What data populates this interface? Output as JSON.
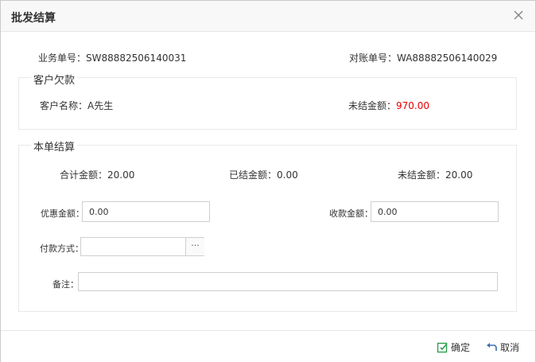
{
  "dialog": {
    "title": "批发结算",
    "close_icon": "close-icon"
  },
  "header": {
    "order_no_label": "业务单号：SW88882506140031",
    "statement_no_label": "对账单号：WA88882506140029"
  },
  "customer_debt": {
    "legend": "客户欠款",
    "customer_name": "客户名称：A先生",
    "unsettled_label": "未结金额：",
    "unsettled_value": "970.00",
    "unsettled_color": "#e60000"
  },
  "settlement": {
    "legend": "本单结算",
    "total": "合计金额：20.00",
    "settled": "已结金额：0.00",
    "unsettled": "未结金额：20.00",
    "discount_label": "优惠金额：",
    "discount_value": "0.00",
    "received_label": "收款金额：",
    "received_value": "0.00",
    "payment_label": "付款方式：",
    "payment_value": "",
    "payment_button": "···",
    "remark_label": "备注：",
    "remark_value": ""
  },
  "footer": {
    "confirm_label": "确定",
    "cancel_label": "取消",
    "confirm_icon": "edit-check-icon",
    "cancel_icon": "undo-arrow-icon",
    "accent_color": "#2e9d4e",
    "cancel_icon_color": "#3a6fb0"
  }
}
